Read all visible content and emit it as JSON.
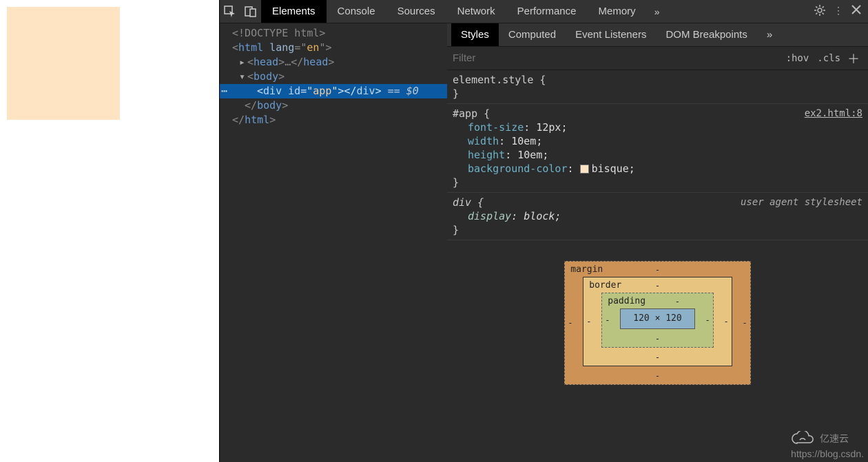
{
  "toolbar": {
    "tabs": [
      "Elements",
      "Console",
      "Sources",
      "Network",
      "Performance",
      "Memory"
    ],
    "active_tab": "Elements"
  },
  "dom": {
    "doctype": "<!DOCTYPE html>",
    "html_open_tag": "html",
    "html_open_attr": "lang",
    "html_open_val": "en",
    "head_open": "head",
    "head_ellipsis": "…",
    "body_tag": "body",
    "sel_tag": "div",
    "sel_attr": "id",
    "sel_val": "app",
    "eq0": " == $0",
    "body_close": "</body>",
    "html_close": "</html>"
  },
  "styles_tabs": {
    "items": [
      "Styles",
      "Computed",
      "Event Listeners",
      "DOM Breakpoints"
    ],
    "active": "Styles"
  },
  "filter": {
    "placeholder": "Filter",
    "hov": ":hov",
    "cls": ".cls"
  },
  "rules": {
    "r0": {
      "selector": "element.style {",
      "close": "}"
    },
    "r1": {
      "origin": "ex2.html:8",
      "selector": "#app {",
      "d0p": "font-size",
      "d0v": "12px;",
      "d1p": "width",
      "d1v": "10em;",
      "d2p": "height",
      "d2v": "10em;",
      "d3p": "background-color",
      "d3v": "bisque;",
      "close": "}"
    },
    "r2": {
      "origin": "user agent stylesheet",
      "selector": "div {",
      "d0p": "display",
      "d0v": "block;",
      "close": "}"
    }
  },
  "boxmodel": {
    "margin_label": "margin",
    "border_label": "border",
    "padding_label": "padding",
    "content": "120 × 120",
    "dash": "-"
  },
  "watermark": {
    "url": "https://blog.csdn.",
    "brand": "亿速云"
  }
}
